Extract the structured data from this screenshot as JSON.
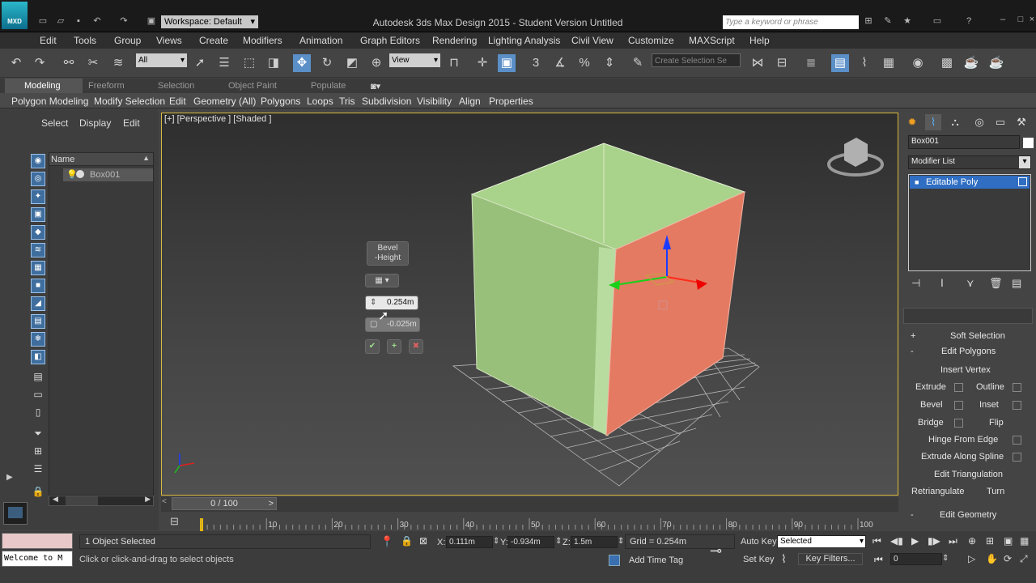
{
  "app": {
    "logo": "MXD",
    "title": "Autodesk 3ds Max Design 2015 - Student Version   Untitled",
    "workspace": "Workspace: Default",
    "search_placeholder": "Type a keyword or phrase"
  },
  "menu": [
    "Edit",
    "Tools",
    "Group",
    "Views",
    "Create",
    "Modifiers",
    "Animation",
    "Graph Editors",
    "Rendering",
    "Lighting Analysis",
    "Civil View",
    "Customize",
    "MAXScript",
    "Help"
  ],
  "toolbar": {
    "filter": "All",
    "ref_coord": "View",
    "selection_set": "Create Selection Se"
  },
  "ribbon_tabs": [
    "Modeling",
    "Freeform",
    "Selection",
    "Object Paint",
    "Populate"
  ],
  "ribbon_items": [
    "Polygon Modeling",
    "Modify Selection",
    "Edit",
    "Geometry (All)",
    "Polygons",
    "Loops",
    "Tris",
    "Subdivision",
    "Visibility",
    "Align",
    "Properties"
  ],
  "scene_explorer": {
    "tabs": [
      "Select",
      "Display",
      "Edit"
    ],
    "column": "Name",
    "objects": [
      "Box001"
    ]
  },
  "viewport": {
    "label": "[+] [Perspective ] [Shaded ]"
  },
  "caddy": {
    "title": "Bevel",
    "subtitle": "-Height",
    "height_value": "0.254m",
    "outline_value": "-0.025m"
  },
  "timeline": {
    "frame": "0 / 100",
    "ticks": [
      "0",
      "10",
      "20",
      "30",
      "40",
      "50",
      "60",
      "70",
      "80",
      "90",
      "100"
    ]
  },
  "command_panel": {
    "object_name": "Box001",
    "modifier_list": "Modifier List",
    "stack": [
      "Editable Poly"
    ],
    "rollouts": {
      "soft": "Soft Selection",
      "edit_polys": "Edit Polygons",
      "edit_geom": "Edit Geometry",
      "plus": "+",
      "minus": "-"
    },
    "buttons": {
      "insert_vertex": "Insert Vertex",
      "extrude": "Extrude",
      "outline": "Outline",
      "bevel": "Bevel",
      "inset": "Inset",
      "bridge": "Bridge",
      "flip": "Flip",
      "hinge": "Hinge From Edge",
      "extrude_spline": "Extrude Along Spline",
      "edit_tri": "Edit Triangulation",
      "retriangulate": "Retriangulate",
      "turn": "Turn"
    }
  },
  "status": {
    "maxscript": "Welcome to M",
    "selected": "1 Object Selected",
    "prompt": "Click or click-and-drag to select objects",
    "x_label": "X:",
    "x": "0.111m",
    "y_label": "Y:",
    "y": "-0.934m",
    "z_label": "Z:",
    "z": "1.5m",
    "grid": "Grid = 0.254m",
    "add_time_tag": "Add Time Tag",
    "auto_key": "Auto Key",
    "set_key": "Set Key",
    "key_mode": "Selected",
    "key_filters": "Key Filters...",
    "frame": "0"
  }
}
